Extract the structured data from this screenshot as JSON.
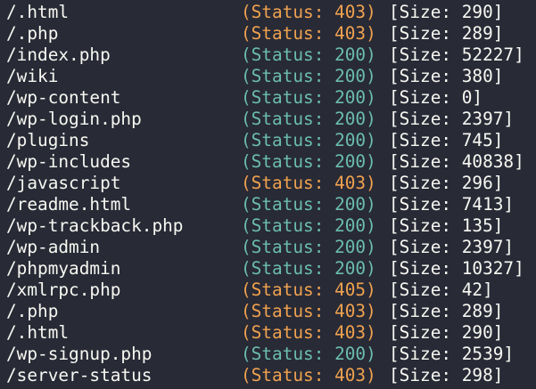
{
  "colors": {
    "background": "#282a36",
    "foreground": "#f8f8f2",
    "status_200": "#6bbdad",
    "status_4xx": "#f0a24f"
  },
  "results": [
    {
      "path": "/.html",
      "status": "(Status: 403)",
      "code": "403",
      "size": "[Size: 290]"
    },
    {
      "path": "/.php",
      "status": "(Status: 403)",
      "code": "403",
      "size": "[Size: 289]"
    },
    {
      "path": "/index.php",
      "status": "(Status: 200)",
      "code": "200",
      "size": "[Size: 52227]"
    },
    {
      "path": "/wiki",
      "status": "(Status: 200)",
      "code": "200",
      "size": "[Size: 380]"
    },
    {
      "path": "/wp-content",
      "status": "(Status: 200)",
      "code": "200",
      "size": "[Size: 0]"
    },
    {
      "path": "/wp-login.php",
      "status": "(Status: 200)",
      "code": "200",
      "size": "[Size: 2397]"
    },
    {
      "path": "/plugins",
      "status": "(Status: 200)",
      "code": "200",
      "size": "[Size: 745]"
    },
    {
      "path": "/wp-includes",
      "status": "(Status: 200)",
      "code": "200",
      "size": "[Size: 40838]"
    },
    {
      "path": "/javascript",
      "status": "(Status: 403)",
      "code": "403",
      "size": "[Size: 296]"
    },
    {
      "path": "/readme.html",
      "status": "(Status: 200)",
      "code": "200",
      "size": "[Size: 7413]"
    },
    {
      "path": "/wp-trackback.php",
      "status": "(Status: 200)",
      "code": "200",
      "size": "[Size: 135]"
    },
    {
      "path": "/wp-admin",
      "status": "(Status: 200)",
      "code": "200",
      "size": "[Size: 2397]"
    },
    {
      "path": "/phpmyadmin",
      "status": "(Status: 200)",
      "code": "200",
      "size": "[Size: 10327]"
    },
    {
      "path": "/xmlrpc.php",
      "status": "(Status: 405)",
      "code": "405",
      "size": "[Size: 42]"
    },
    {
      "path": "/.php",
      "status": "(Status: 403)",
      "code": "403",
      "size": "[Size: 289]"
    },
    {
      "path": "/.html",
      "status": "(Status: 403)",
      "code": "403",
      "size": "[Size: 290]"
    },
    {
      "path": "/wp-signup.php",
      "status": "(Status: 200)",
      "code": "200",
      "size": "[Size: 2539]"
    },
    {
      "path": "/server-status",
      "status": "(Status: 403)",
      "code": "403",
      "size": "[Size: 298]"
    }
  ]
}
